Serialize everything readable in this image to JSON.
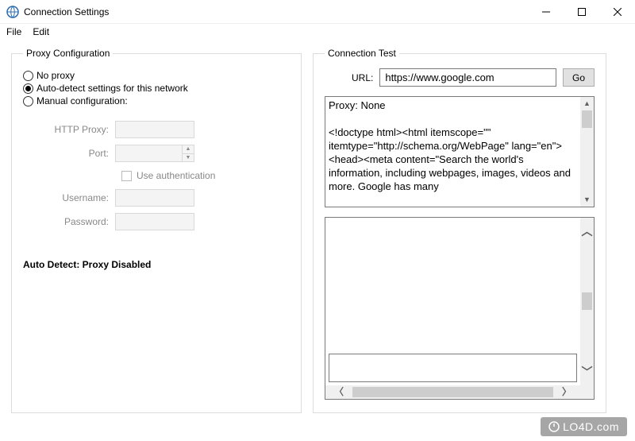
{
  "window": {
    "title": "Connection Settings"
  },
  "menu": {
    "file": "File",
    "edit": "Edit"
  },
  "proxy": {
    "legend": "Proxy Configuration",
    "no_proxy": "No proxy",
    "auto_detect": "Auto-detect settings for this network",
    "manual": "Manual configuration:",
    "http_proxy_label": "HTTP Proxy:",
    "port_label": "Port:",
    "use_auth": "Use authentication",
    "username_label": "Username:",
    "password_label": "Password:",
    "status": "Auto Detect: Proxy Disabled"
  },
  "test": {
    "legend": "Connection Test",
    "url_label": "URL:",
    "url_value": "https://www.google.com",
    "go": "Go",
    "output": "Proxy: None\n\n<!doctype html><html itemscope=\"\" itemtype=\"http://schema.org/WebPage\" lang=\"en\"><head><meta content=\"Search the world's information, including webpages, images, videos and more. Google has many"
  },
  "watermark": "LO4D.com"
}
